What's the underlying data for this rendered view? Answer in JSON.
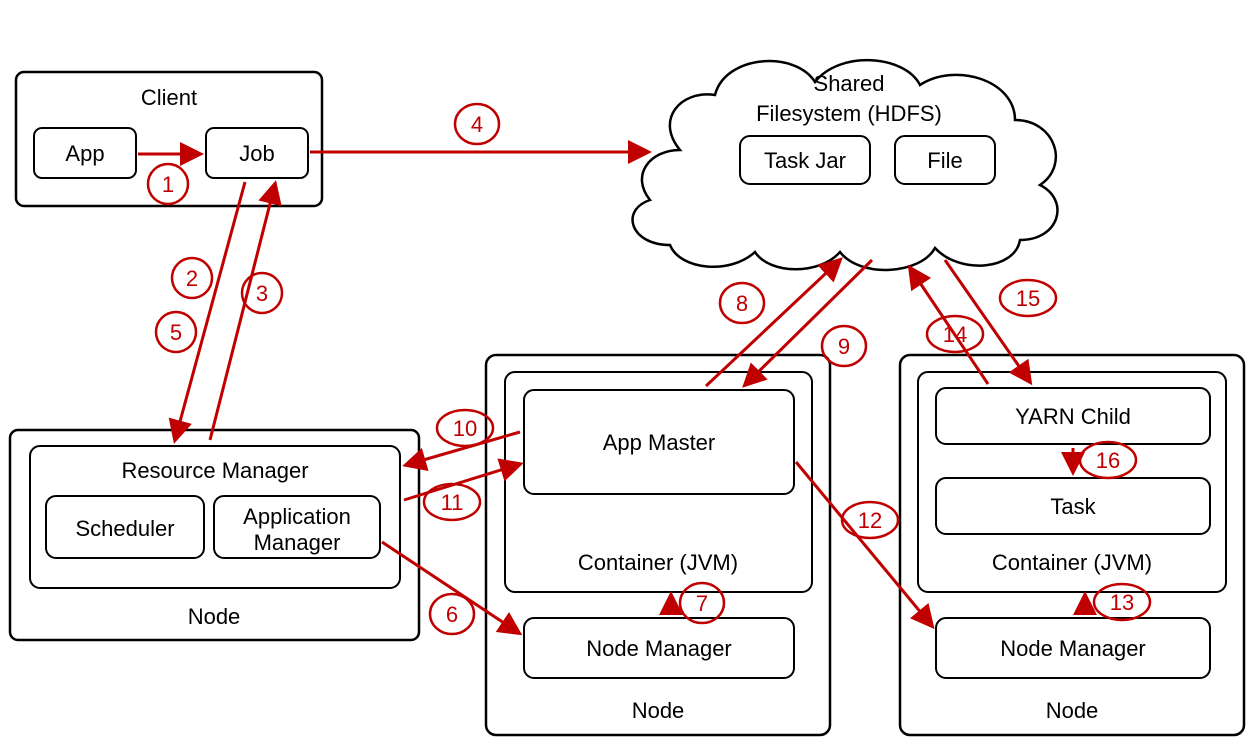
{
  "nodes": {
    "client": {
      "title": "Client",
      "app": "App",
      "job": "Job"
    },
    "hdfs": {
      "title1": "Shared",
      "title2": "Filesystem (HDFS)",
      "taskjar": "Task Jar",
      "file": "File"
    },
    "rm": {
      "node": "Node",
      "title": "Resource Manager",
      "scheduler": "Scheduler",
      "appmgr1": "Application",
      "appmgr2": "Manager"
    },
    "appmaster_node": {
      "node": "Node",
      "container": "Container (JVM)",
      "appmaster": "App Master",
      "nodemgr": "Node Manager"
    },
    "task_node": {
      "node": "Node",
      "container": "Container (JVM)",
      "yarnchild": "YARN Child",
      "task": "Task",
      "nodemgr": "Node Manager"
    }
  },
  "steps": {
    "s1": "1",
    "s2": "2",
    "s3": "3",
    "s4": "4",
    "s5": "5",
    "s6": "6",
    "s7": "7",
    "s8": "8",
    "s9": "9",
    "s10": "10",
    "s11": "11",
    "s12": "12",
    "s13": "13",
    "s14": "14",
    "s15": "15",
    "s16": "16"
  }
}
